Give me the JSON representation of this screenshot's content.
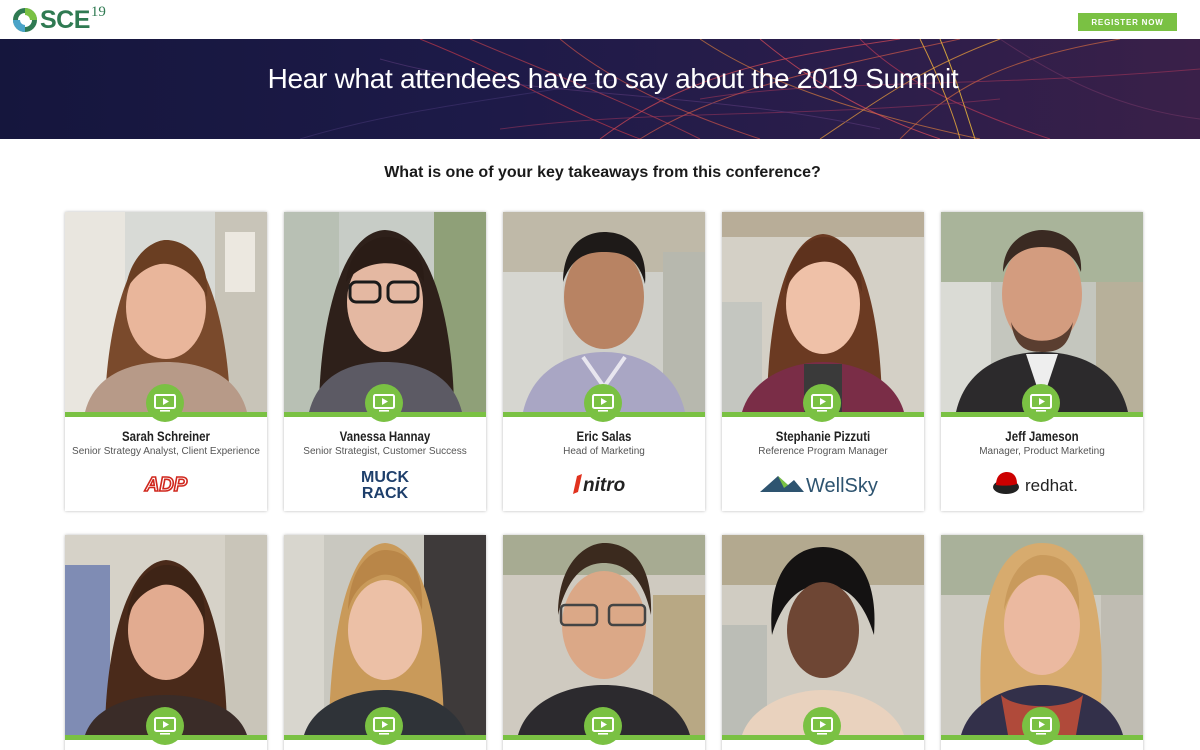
{
  "header": {
    "logo_text": "SCE",
    "logo_year": "19",
    "register_label": "REGISTER NOW",
    "brand_green": "#7ac143"
  },
  "hero": {
    "title": "Hear what attendees have to say about the 2019 Summit"
  },
  "section": {
    "question": "What is one of your key takeaways from this conference?"
  },
  "attendees": [
    {
      "name": "Sarah Schreiner",
      "title": "Senior Strategy Analyst, Client Experience",
      "company": "ADP",
      "company_logo_text": "ADP",
      "play_icon": "video-play-icon"
    },
    {
      "name": "Vanessa Hannay",
      "title": "Senior Strategist, Customer Success",
      "company": "Muck Rack",
      "company_logo_text": "MUCK RACK",
      "play_icon": "video-play-icon"
    },
    {
      "name": "Eric Salas",
      "title": "Head of Marketing",
      "company": "Nitro",
      "company_logo_text": "nitro",
      "play_icon": "video-play-icon"
    },
    {
      "name": "Stephanie Pizzuti",
      "title": "Reference Program Manager",
      "company": "WellSky",
      "company_logo_text": "WellSky",
      "play_icon": "video-play-icon"
    },
    {
      "name": "Jeff Jameson",
      "title": "Manager, Product Marketing",
      "company": "Red Hat",
      "company_logo_text": "redhat.",
      "play_icon": "video-play-icon"
    },
    {
      "name": "",
      "title": "",
      "company": "",
      "play_icon": "video-play-icon"
    },
    {
      "name": "",
      "title": "",
      "company": "",
      "play_icon": "video-play-icon"
    },
    {
      "name": "",
      "title": "",
      "company": "",
      "play_icon": "video-play-icon"
    },
    {
      "name": "",
      "title": "",
      "company": "",
      "play_icon": "video-play-icon"
    },
    {
      "name": "",
      "title": "",
      "company": "",
      "play_icon": "video-play-icon"
    }
  ]
}
